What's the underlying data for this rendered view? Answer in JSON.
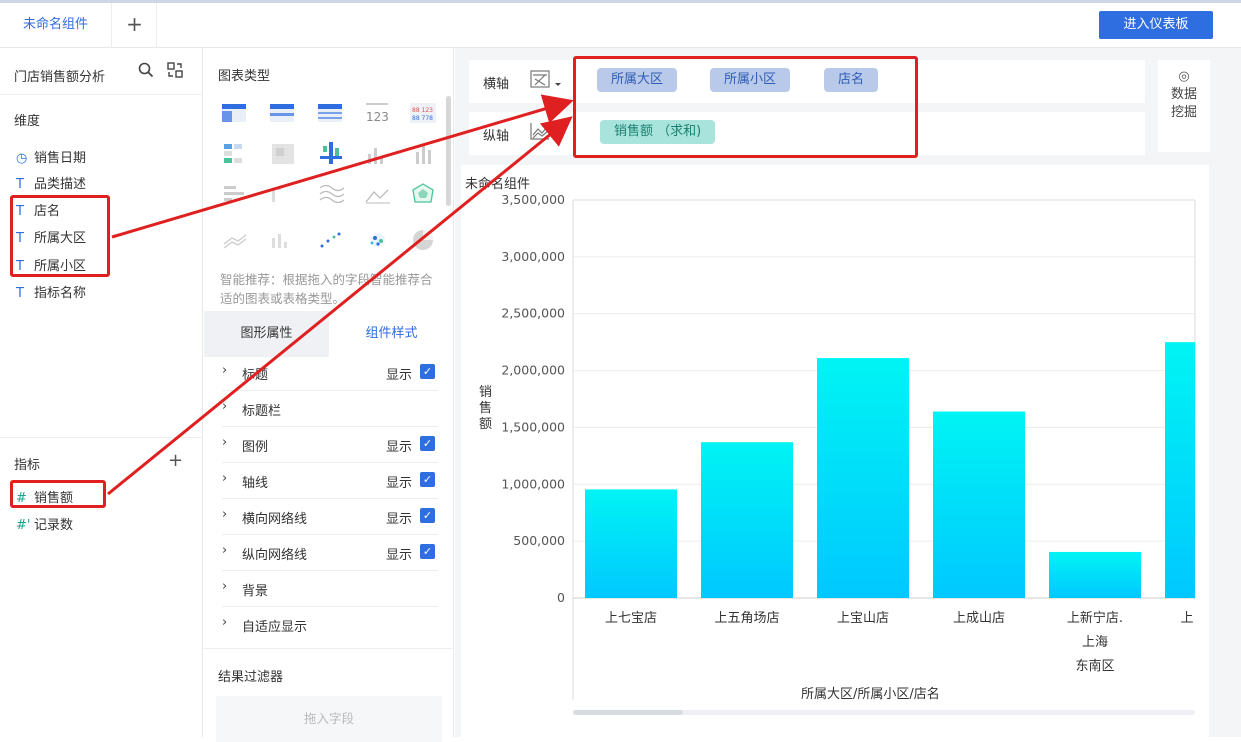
{
  "tabs": {
    "active": "未命名组件",
    "add": "+"
  },
  "enter_dashboard": "进入仪表板",
  "dataset": {
    "title": "门店销售额分析"
  },
  "dimensions": {
    "label": "维度",
    "fields": [
      {
        "icon": "clock-icon",
        "icon_glyph": "◷",
        "name": "销售日期"
      },
      {
        "icon": "text-type-icon",
        "icon_glyph": "T",
        "name": "品类描述"
      },
      {
        "icon": "text-type-icon",
        "icon_glyph": "T",
        "name": "店名"
      },
      {
        "icon": "text-type-icon",
        "icon_glyph": "T",
        "name": "所属大区"
      },
      {
        "icon": "text-type-icon",
        "icon_glyph": "T",
        "name": "所属小区"
      },
      {
        "icon": "text-type-icon",
        "icon_glyph": "T",
        "name": "指标名称"
      }
    ]
  },
  "measures": {
    "label": "指标",
    "add": "+",
    "fields": [
      {
        "icon": "number-type-icon",
        "icon_glyph": "#",
        "name": "销售额"
      },
      {
        "icon": "number-type-icon",
        "icon_glyph": "#'",
        "name": "记录数"
      }
    ]
  },
  "chart_types": {
    "title": "图表类型"
  },
  "hint": "智能推荐：根据拖入的字段智能推荐合适的图表或表格类型。",
  "subtabs": {
    "graph_props": "图形属性",
    "component_style": "组件样式"
  },
  "properties": [
    {
      "label": "标题",
      "show": "显示",
      "checked": true
    },
    {
      "label": "标题栏",
      "show": "",
      "checked": false
    },
    {
      "label": "图例",
      "show": "显示",
      "checked": true
    },
    {
      "label": "轴线",
      "show": "显示",
      "checked": true
    },
    {
      "label": "横向网络线",
      "show": "显示",
      "checked": true
    },
    {
      "label": "纵向网络线",
      "show": "显示",
      "checked": true
    },
    {
      "label": "背景",
      "show": "",
      "checked": false
    },
    {
      "label": "自适应显示",
      "show": "",
      "checked": false
    }
  ],
  "result_filter": {
    "title": "结果过滤器",
    "drop_hint": "拖入字段"
  },
  "axes": {
    "x": {
      "label": "横轴",
      "pills": [
        "所属大区",
        "所属小区",
        "店名"
      ]
    },
    "y": {
      "label": "纵轴",
      "pills": [
        "销售额 （求和)"
      ]
    }
  },
  "data_mining": {
    "line1": "数据",
    "line2": "挖掘"
  },
  "chart_title": "未命名组件",
  "chart_data": {
    "type": "bar",
    "categories": [
      "上七宝店",
      "上五角场店",
      "上宝山店",
      "上成山店",
      "上新宁店.上海东南区",
      "上"
    ],
    "category_lines": [
      [
        "上七宝店"
      ],
      [
        "上五角场店"
      ],
      [
        "上宝山店"
      ],
      [
        "上成山店"
      ],
      [
        "上新宁店.",
        "上海",
        "东南区"
      ],
      [
        "上"
      ]
    ],
    "values": [
      955000,
      1370000,
      2110000,
      1640000,
      405000,
      2250000
    ],
    "ylabel": "销售额",
    "xlabel": "所属大区/所属小区/店名",
    "ylim": [
      0,
      3500000
    ],
    "yticks": [
      "0",
      "500,000",
      "1,000,000",
      "1,500,000",
      "2,000,000",
      "2,500,000",
      "3,000,000",
      "3,500,000"
    ],
    "grid": true,
    "bar_gradient": [
      "#00f4f4",
      "#00c8ff"
    ]
  }
}
